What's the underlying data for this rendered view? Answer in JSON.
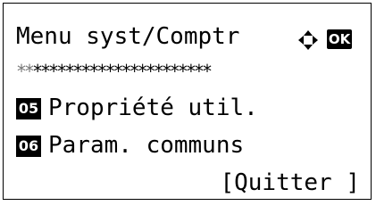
{
  "screen": {
    "title": "Menu syst/Comptr",
    "ok_label": "OK",
    "nav_icon": "four-way-arrow-icon",
    "password_stars": "**********************"
  },
  "menu": {
    "items": [
      {
        "number": "05",
        "label": "Propriété util."
      },
      {
        "number": "06",
        "label": "Param. communs"
      }
    ]
  },
  "softkey": {
    "exit_label": "[Quitter ]"
  },
  "colors": {
    "foreground": "#000000",
    "background": "#ffffff"
  }
}
